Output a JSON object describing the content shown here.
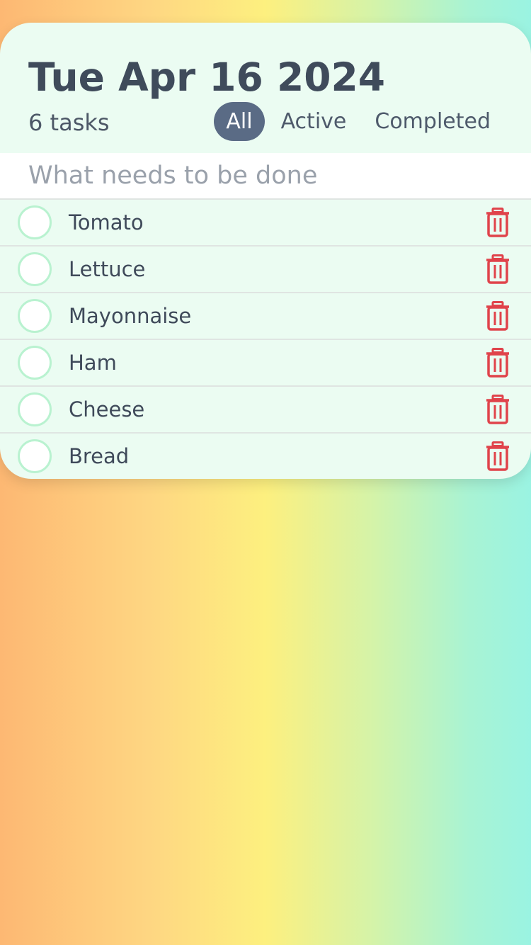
{
  "header": {
    "date": "Tue Apr 16 2024",
    "task_count": "6 tasks",
    "filters": [
      {
        "label": "All",
        "active": true
      },
      {
        "label": "Active",
        "active": false
      },
      {
        "label": "Completed",
        "active": false
      }
    ]
  },
  "new_task": {
    "placeholder": "What needs to be done"
  },
  "tasks": [
    {
      "label": "Tomato",
      "completed": false
    },
    {
      "label": "Lettuce",
      "completed": false
    },
    {
      "label": "Mayonnaise",
      "completed": false
    },
    {
      "label": "Ham",
      "completed": false
    },
    {
      "label": "Cheese",
      "completed": false
    },
    {
      "label": "Bread",
      "completed": false
    }
  ],
  "icons": {
    "delete": "trash-icon",
    "checkbox": "circle-checkbox-icon"
  },
  "colors": {
    "card_background": "#ebfcf2",
    "active_filter": "#5a6b85",
    "delete_icon": "#e0434b",
    "checkbox_border": "#b9f2d0"
  }
}
